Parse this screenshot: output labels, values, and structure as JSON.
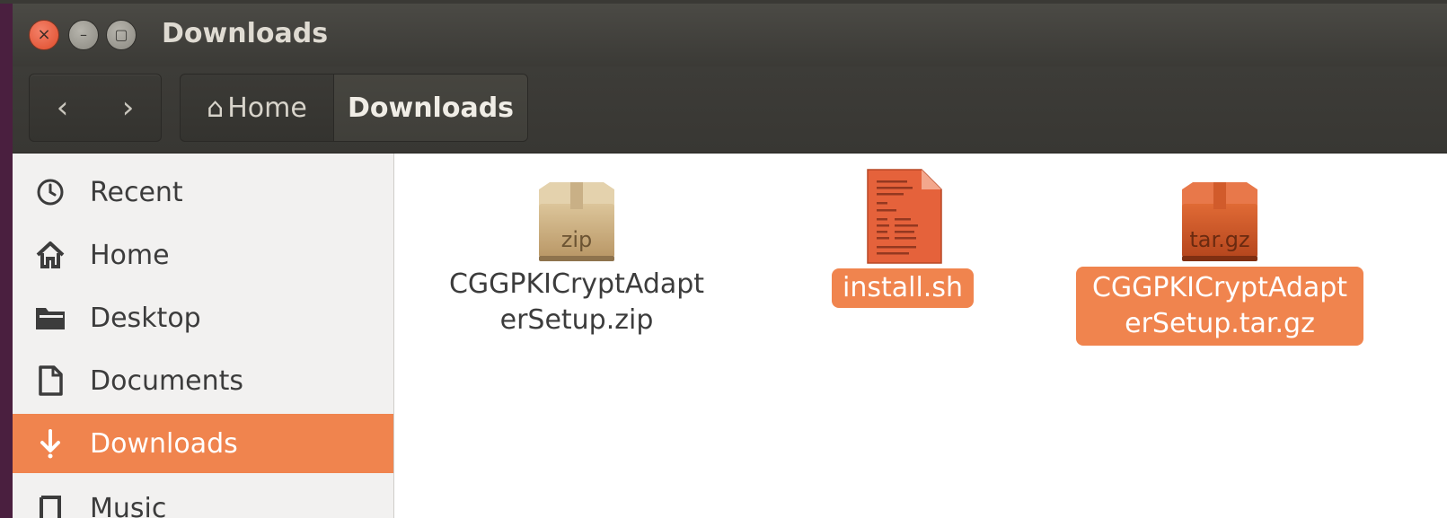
{
  "window": {
    "title": "Downloads"
  },
  "titlebar": {
    "close_glyph": "×",
    "minimize_glyph": "–",
    "maximize_glyph": "▢"
  },
  "nav": {
    "back_glyph": "‹",
    "forward_glyph": "›"
  },
  "breadcrumb": {
    "home_label": "Home",
    "home_glyph": "⌂",
    "current_label": "Downloads"
  },
  "sidebar": {
    "items": [
      {
        "label": "Recent",
        "icon": "clock-icon"
      },
      {
        "label": "Home",
        "icon": "home-icon"
      },
      {
        "label": "Desktop",
        "icon": "folder-icon"
      },
      {
        "label": "Documents",
        "icon": "document-icon"
      },
      {
        "label": "Downloads",
        "icon": "download-icon",
        "active": true
      },
      {
        "label": "Music",
        "icon": "music-icon"
      }
    ]
  },
  "files": [
    {
      "name_line1": "CGGPKICryptAdapt",
      "name_line2": "erSetup.zip",
      "icon_text": "zip",
      "icon": "zip-archive-icon",
      "selected": false
    },
    {
      "name_line1": "install.sh",
      "icon": "script-file-icon",
      "selected": true
    },
    {
      "name_line1": "CGGPKICryptAdapt",
      "name_line2": "erSetup.tar.gz",
      "icon_text": "tar.gz",
      "icon": "targz-archive-icon",
      "selected": true
    }
  ],
  "colors": {
    "accent": "#f0844e",
    "titlebar": "#3f3e3a",
    "sidebar_bg": "#f2f1f0"
  }
}
